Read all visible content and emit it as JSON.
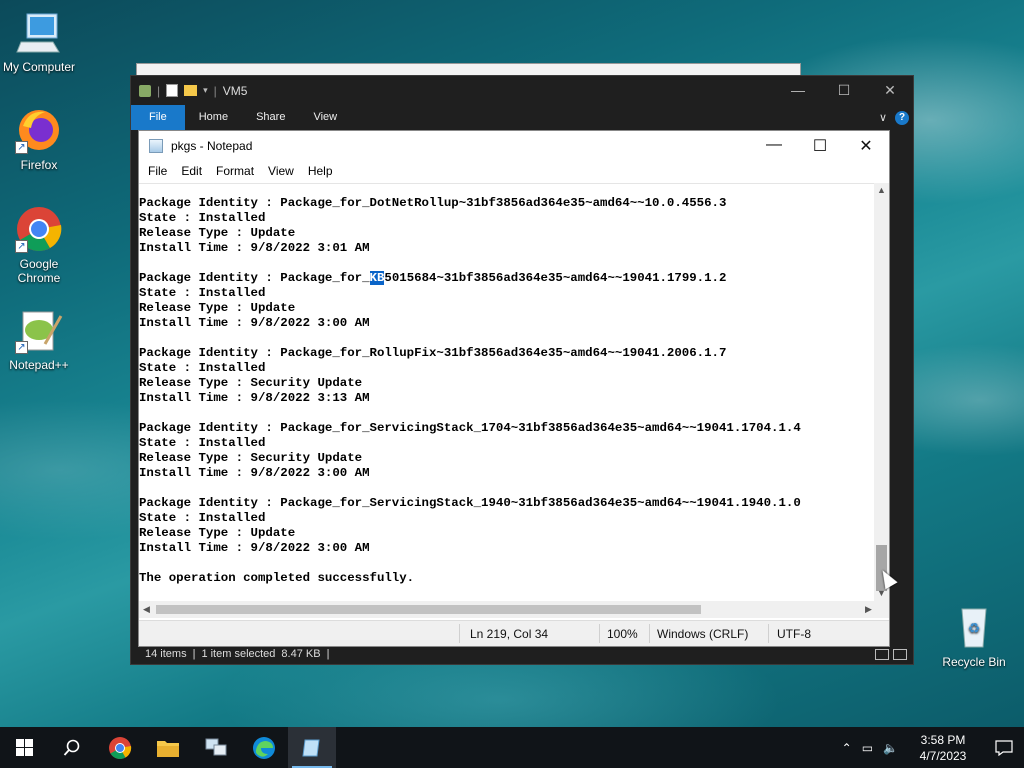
{
  "desktop": {
    "icons": [
      {
        "label": "My Computer"
      },
      {
        "label": "Firefox"
      },
      {
        "label": "Google Chrome"
      },
      {
        "label": "Notepad++"
      },
      {
        "label": "Recycle Bin"
      }
    ]
  },
  "explorer": {
    "title": "VM5",
    "ribbon_tabs": [
      "File",
      "Home",
      "Share",
      "View"
    ],
    "status": {
      "items": "14 items",
      "selected": "1 item selected",
      "size": "8.47 KB"
    }
  },
  "notepad": {
    "title": "pkgs - Notepad",
    "menu": [
      "File",
      "Edit",
      "Format",
      "View",
      "Help"
    ],
    "content_lines_pre": [
      "Package Identity : Package_for_DotNetRollup~31bf3856ad364e35~amd64~~10.0.4556.3",
      "State : Installed",
      "Release Type : Update",
      "Install Time : 9/8/2022 3:01 AM",
      ""
    ],
    "kb_line": {
      "before": "Package Identity : Package_for_",
      "selected": "KB",
      "after": "5015684~31bf3856ad364e35~amd64~~19041.1799.1.2"
    },
    "content_lines_post": [
      "State : Installed",
      "Release Type : Update",
      "Install Time : 9/8/2022 3:00 AM",
      "",
      "Package Identity : Package_for_RollupFix~31bf3856ad364e35~amd64~~19041.2006.1.7",
      "State : Installed",
      "Release Type : Security Update",
      "Install Time : 9/8/2022 3:13 AM",
      "",
      "Package Identity : Package_for_ServicingStack_1704~31bf3856ad364e35~amd64~~19041.1704.1.4",
      "State : Installed",
      "Release Type : Security Update",
      "Install Time : 9/8/2022 3:00 AM",
      "",
      "Package Identity : Package_for_ServicingStack_1940~31bf3856ad364e35~amd64~~19041.1940.1.0",
      "State : Installed",
      "Release Type : Update",
      "Install Time : 9/8/2022 3:00 AM",
      "",
      "The operation completed successfully."
    ],
    "status": {
      "position": "Ln 219, Col 34",
      "zoom": "100%",
      "line_ending": "Windows (CRLF)",
      "encoding": "UTF-8"
    }
  },
  "taskbar": {
    "time": "3:58 PM",
    "date": "4/7/2023",
    "apps": [
      "start-icon",
      "search-icon",
      "chrome-icon",
      "file-explorer-icon",
      "network-icon",
      "edge-icon",
      "notepad-icon"
    ]
  },
  "colors": {
    "accent": "#1979ca",
    "selection": "#0a64c8",
    "taskbar": "#101418"
  }
}
